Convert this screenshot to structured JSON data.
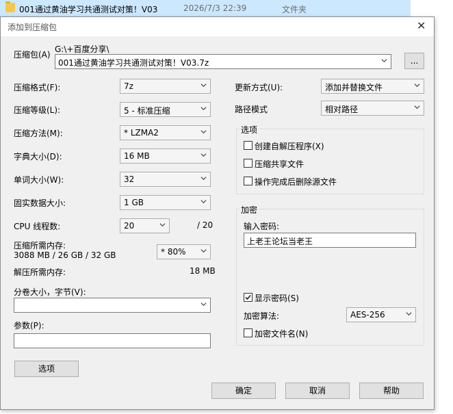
{
  "explorer_row": {
    "name": "001通过黄油学习共通测试对策！V03",
    "date": "2026/7/3 22:39",
    "type": "文件夹"
  },
  "dialog": {
    "title": "添加到压缩包",
    "archive_label": "压缩包(A)",
    "archive_path": "G:\\+百度分享\\",
    "archive_name": "001通过黄油学习共通测试对策！V03.7z",
    "browse_label": "...",
    "format_label": "压缩格式(F):",
    "format_value": "7z",
    "level_label": "压缩等级(L):",
    "level_value": "5 - 标准压缩",
    "method_label": "压缩方法(M):",
    "method_value": "*  LZMA2",
    "dict_label": "字典大小(D):",
    "dict_value": "16 MB",
    "word_label": "单词大小(W):",
    "word_value": "32",
    "solid_label": "固实数据大小:",
    "solid_value": "1 GB",
    "threads_label": "CPU 线程数:",
    "threads_value": "20",
    "threads_total": "/ 20",
    "mem_label": "压缩所需内存:",
    "mem_value": "3088 MB / 26 GB / 32 GB",
    "mem_percent": "*  80%",
    "decomp_label": "解压所需内存:",
    "decomp_value": "18 MB",
    "volume_label": "分卷大小，字节(V):",
    "volume_value": "",
    "params_label": "参数(P):",
    "params_value": "",
    "options_button": "选项",
    "update_label": "更新方式(U):",
    "update_value": "添加并替换文件",
    "path_label": "路径模式",
    "path_value": "相对路径",
    "options_group": "选项",
    "opt_sfx": "创建自解压程序(X)",
    "opt_shared": "压缩共享文件",
    "opt_delete": "操作完成后删除源文件",
    "encrypt_group": "加密",
    "password_label": "输入密码:",
    "password_value": "上老王论坛当老王",
    "show_password": "显示密码(S)",
    "enc_method_label": "加密算法:",
    "enc_method_value": "AES-256",
    "encrypt_names": "加密文件名(N)",
    "ok_button": "确定",
    "cancel_button": "取消",
    "help_button": "帮助"
  },
  "checkboxes": {
    "sfx": false,
    "shared": false,
    "delete": false,
    "show_password": true,
    "encrypt_names": false
  }
}
